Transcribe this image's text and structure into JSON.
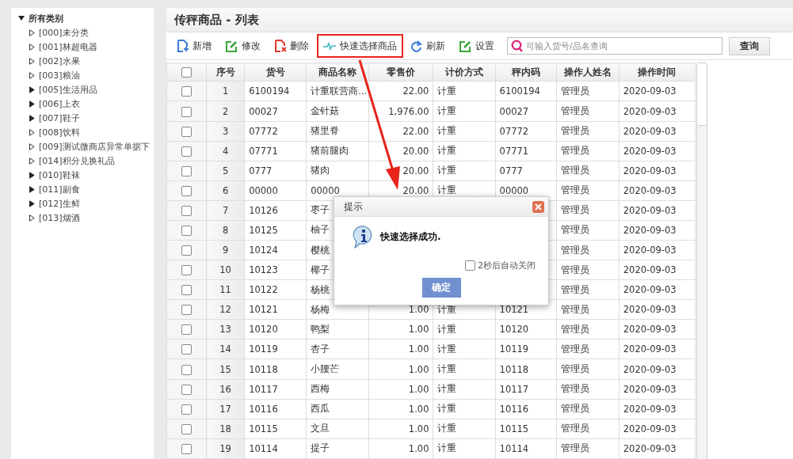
{
  "tree": {
    "label": "所有类别",
    "expanded": true,
    "children": [
      {
        "label": "[000]未分类",
        "has_children": false
      },
      {
        "label": "[001]林超电器",
        "has_children": false
      },
      {
        "label": "[002]水果",
        "has_children": false
      },
      {
        "label": "[003]粮油",
        "has_children": false
      },
      {
        "label": "[005]生活用品",
        "has_children": true
      },
      {
        "label": "[006]上衣",
        "has_children": true
      },
      {
        "label": "[007]鞋子",
        "has_children": true
      },
      {
        "label": "[008]饮料",
        "has_children": false
      },
      {
        "label": "[009]测试微商店异常单据下",
        "has_children": false
      },
      {
        "label": "[014]积分兑换礼品",
        "has_children": false
      },
      {
        "label": "[010]鞋袜",
        "has_children": true
      },
      {
        "label": "[011]副食",
        "has_children": true
      },
      {
        "label": "[012]生鲜",
        "has_children": true
      },
      {
        "label": "[013]烟酒",
        "has_children": false
      }
    ]
  },
  "panel_title": "传秤商品 - 列表",
  "toolbar": [
    {
      "label": "新增",
      "kind": "add",
      "highlighted": false
    },
    {
      "label": "修改",
      "kind": "edit",
      "highlighted": false
    },
    {
      "label": "删除",
      "kind": "delete",
      "highlighted": false
    },
    {
      "label": "快速选择商品",
      "kind": "pulse",
      "highlighted": true
    },
    {
      "label": "刷新",
      "kind": "refresh",
      "highlighted": false
    },
    {
      "label": "设置",
      "kind": "edit",
      "highlighted": false
    }
  ],
  "search": {
    "placeholder": "可输入货号/品名查询",
    "button": "查询"
  },
  "table": {
    "all_checked": false,
    "columns": [
      "序号",
      "货号",
      "商品名称",
      "零售价",
      "计价方式",
      "秤内码",
      "操作人姓名",
      "操作时间"
    ],
    "rows": [
      {
        "cells": [
          "1",
          "6100194",
          "计重联营商...",
          "22.00",
          "计重",
          "6100194",
          "管理员",
          "2020-09-03"
        ],
        "checked": false
      },
      {
        "cells": [
          "2",
          "00027",
          "金针菇",
          "1,976.00",
          "计重",
          "00027",
          "管理员",
          "2020-09-03"
        ],
        "checked": false
      },
      {
        "cells": [
          "3",
          "07772",
          "猪里脊",
          "22.00",
          "计重",
          "07772",
          "管理员",
          "2020-09-03"
        ],
        "checked": false
      },
      {
        "cells": [
          "4",
          "07771",
          "猪前腿肉",
          "20.00",
          "计重",
          "07771",
          "管理员",
          "2020-09-03"
        ],
        "checked": false
      },
      {
        "cells": [
          "5",
          "0777",
          "猪肉",
          "20.00",
          "计重",
          "0777",
          "管理员",
          "2020-09-03"
        ],
        "checked": false
      },
      {
        "cells": [
          "6",
          "00000",
          "00000",
          "20.00",
          "计重",
          "00000",
          "管理员",
          "2020-09-03"
        ],
        "checked": false
      },
      {
        "cells": [
          "7",
          "10126",
          "枣子",
          null,
          null,
          null,
          "管理员",
          "2020-09-03"
        ],
        "checked": false
      },
      {
        "cells": [
          "8",
          "10125",
          "柚子",
          null,
          null,
          null,
          "管理员",
          "2020-09-03"
        ],
        "checked": false
      },
      {
        "cells": [
          "9",
          "10124",
          "樱桃",
          null,
          null,
          null,
          "管理员",
          "2020-09-03"
        ],
        "checked": false
      },
      {
        "cells": [
          "10",
          "10123",
          "椰子",
          null,
          null,
          null,
          "管理员",
          "2020-09-03"
        ],
        "checked": false
      },
      {
        "cells": [
          "11",
          "10122",
          "杨桃",
          null,
          null,
          null,
          "管理员",
          "2020-09-03"
        ],
        "checked": false
      },
      {
        "cells": [
          "12",
          "10121",
          "杨梅",
          "1.00",
          "计重",
          "10121",
          "管理员",
          "2020-09-03"
        ],
        "checked": false
      },
      {
        "cells": [
          "13",
          "10120",
          "鸭梨",
          "1.00",
          "计重",
          "10120",
          "管理员",
          "2020-09-03"
        ],
        "checked": false
      },
      {
        "cells": [
          "14",
          "10119",
          "杏子",
          "1.00",
          "计重",
          "10119",
          "管理员",
          "2020-09-03"
        ],
        "checked": false
      },
      {
        "cells": [
          "15",
          "10118",
          "小腰芒",
          "1.00",
          "计重",
          "10118",
          "管理员",
          "2020-09-03"
        ],
        "checked": false
      },
      {
        "cells": [
          "16",
          "10117",
          "西梅",
          "1.00",
          "计重",
          "10117",
          "管理员",
          "2020-09-03"
        ],
        "checked": false
      },
      {
        "cells": [
          "17",
          "10116",
          "西瓜",
          "1.00",
          "计重",
          "10116",
          "管理员",
          "2020-09-03"
        ],
        "checked": false
      },
      {
        "cells": [
          "18",
          "10115",
          "文旦",
          "1.00",
          "计重",
          "10115",
          "管理员",
          "2020-09-03"
        ],
        "checked": false
      },
      {
        "cells": [
          "19",
          "10114",
          "提子",
          "1.00",
          "计重",
          "10114",
          "管理员",
          "2020-09-03"
        ],
        "checked": false
      }
    ]
  },
  "dialog": {
    "title": "提示",
    "message": "快速选择成功.",
    "auto_close": {
      "label": "2秒后自动关闭",
      "checked": false
    },
    "button": "确定"
  }
}
